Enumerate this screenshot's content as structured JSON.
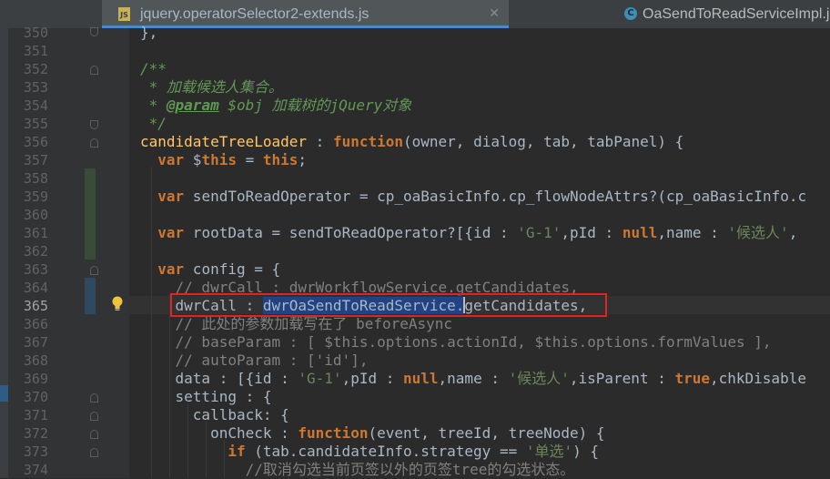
{
  "tabs": [
    {
      "label": "jquery.operatorSelector2-extends.js",
      "icon": "js-file-icon",
      "active": true,
      "close": "✕"
    },
    {
      "label": "OaSendToReadServiceImpl.ja",
      "icon": "java-class-icon",
      "active": false
    }
  ],
  "tab_icon_text": {
    "js": "JS",
    "java": "C"
  },
  "current_line": 365,
  "lines": [
    {
      "n": "350",
      "code": "},"
    },
    {
      "n": "351",
      "code": ""
    },
    {
      "n": "352",
      "code": "/**"
    },
    {
      "n": "353",
      "code": " * 加载候选人集合。"
    },
    {
      "n": "354",
      "code": " * @param $obj 加载树的jQuery对象"
    },
    {
      "n": "355",
      "code": " */"
    },
    {
      "n": "356",
      "code": "candidateTreeLoader : function(owner, dialog, tab, tabPanel) {"
    },
    {
      "n": "357",
      "code": "  var $this = this;"
    },
    {
      "n": "358",
      "code": ""
    },
    {
      "n": "359",
      "code": "  var sendToReadOperator = cp_oaBasicInfo.cp_flowNodeAttrs?(cp_oaBasicInfo.c"
    },
    {
      "n": "360",
      "code": ""
    },
    {
      "n": "361",
      "code": "  var rootData = sendToReadOperator?[{id : 'G-1',pId : null,name : '候选人',"
    },
    {
      "n": "362",
      "code": ""
    },
    {
      "n": "363",
      "code": "  var config = {"
    },
    {
      "n": "364",
      "code": "    // dwrCall : dwrWorkflowService.getCandidates,"
    },
    {
      "n": "365",
      "code": "    dwrCall : dwrOaSendToReadService.getCandidates,"
    },
    {
      "n": "366",
      "code": "    // 此处的参数加载写在了 beforeAsync"
    },
    {
      "n": "367",
      "code": "    // baseParam : [ $this.options.actionId, $this.options.formValues ],"
    },
    {
      "n": "368",
      "code": "    // autoParam : ['id'],"
    },
    {
      "n": "369",
      "code": "    data : [{id : 'G-1',pId : null,name : '候选人',isParent : true,chkDisable"
    },
    {
      "n": "370",
      "code": "    setting : {"
    },
    {
      "n": "371",
      "code": "      callback: {"
    },
    {
      "n": "372",
      "code": "        onCheck : function(event, treeId, treeNode) {"
    },
    {
      "n": "373",
      "code": "          if (tab.candidateInfo.strategy == '单选') {"
    },
    {
      "n": "374",
      "code": "            //取消勾选当前页签以外的页签tree的勾选状态。"
    }
  ],
  "colors": {
    "keyword": "#cc7832",
    "doc_comment": "#629755",
    "line_comment": "#808080",
    "string": "#6a8759",
    "function": "#ffc66d",
    "selection": "#214283",
    "annotation_box": "#e02424"
  }
}
